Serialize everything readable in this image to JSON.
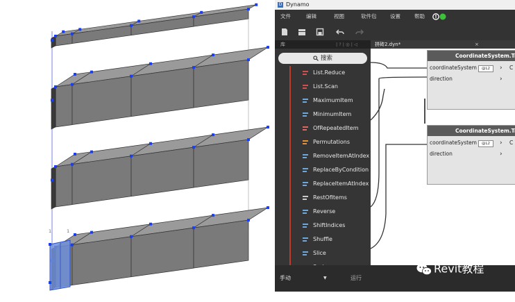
{
  "revit_view": {
    "grip_labels": [
      "1",
      "1"
    ],
    "colors": {
      "block": "#7a7a7a",
      "block_top": "#9a9a9a",
      "grip": "#1a3ef0",
      "selected": "#6f8fd8"
    }
  },
  "dynamo": {
    "window_title": "Dynamo",
    "menu": [
      "文件",
      "编辑",
      "视图",
      "软件包",
      "设置",
      "帮助"
    ],
    "library_header": "库",
    "library_tabs": "| ? | ◎ | ◁",
    "search_placeholder": "搜索",
    "library_items": [
      {
        "label": "List.Reduce",
        "icon": "reduce-icon"
      },
      {
        "label": "List.Scan",
        "icon": "scan-icon"
      },
      {
        "label": "MaximumItem",
        "icon": "maximum-icon"
      },
      {
        "label": "MinimumItem",
        "icon": "minimum-icon"
      },
      {
        "label": "OfRepeatedItem",
        "icon": "repeated-icon"
      },
      {
        "label": "Permutations",
        "icon": "permutations-icon"
      },
      {
        "label": "RemoveItemAtIndex",
        "icon": "remove-index-icon"
      },
      {
        "label": "ReplaceByCondition",
        "icon": "replace-condition-icon"
      },
      {
        "label": "ReplaceItemAtIndex",
        "icon": "replace-index-icon"
      },
      {
        "label": "RestOfItems",
        "icon": "rest-icon"
      },
      {
        "label": "Reverse",
        "icon": "reverse-icon"
      },
      {
        "label": "ShiftIndices",
        "icon": "shift-icon"
      },
      {
        "label": "Shuffle",
        "icon": "shuffle-icon"
      },
      {
        "label": "Slice",
        "icon": "slice-icon"
      },
      {
        "label": "Sort",
        "icon": "sort-icon"
      }
    ],
    "canvas_tab": "拼砖2.dyn*",
    "canvas_tab_close": "×",
    "nodes": [
      {
        "title": "CoordinateSystem.Trans",
        "ports": [
          "coordinateSystem",
          "direction"
        ],
        "lacing": "@L2",
        "output": "C"
      },
      {
        "title": "CoordinateSystem.Trans",
        "ports": [
          "coordinateSystem",
          "direction"
        ],
        "lacing": "@L2",
        "output": "C"
      }
    ],
    "run_mode": "手动",
    "run_button": "运行",
    "colors": {
      "accent_green": "#3cc13b",
      "panel": "#353535",
      "item_bar": "#c0392b"
    }
  },
  "watermark": {
    "text": "Revit教程"
  }
}
